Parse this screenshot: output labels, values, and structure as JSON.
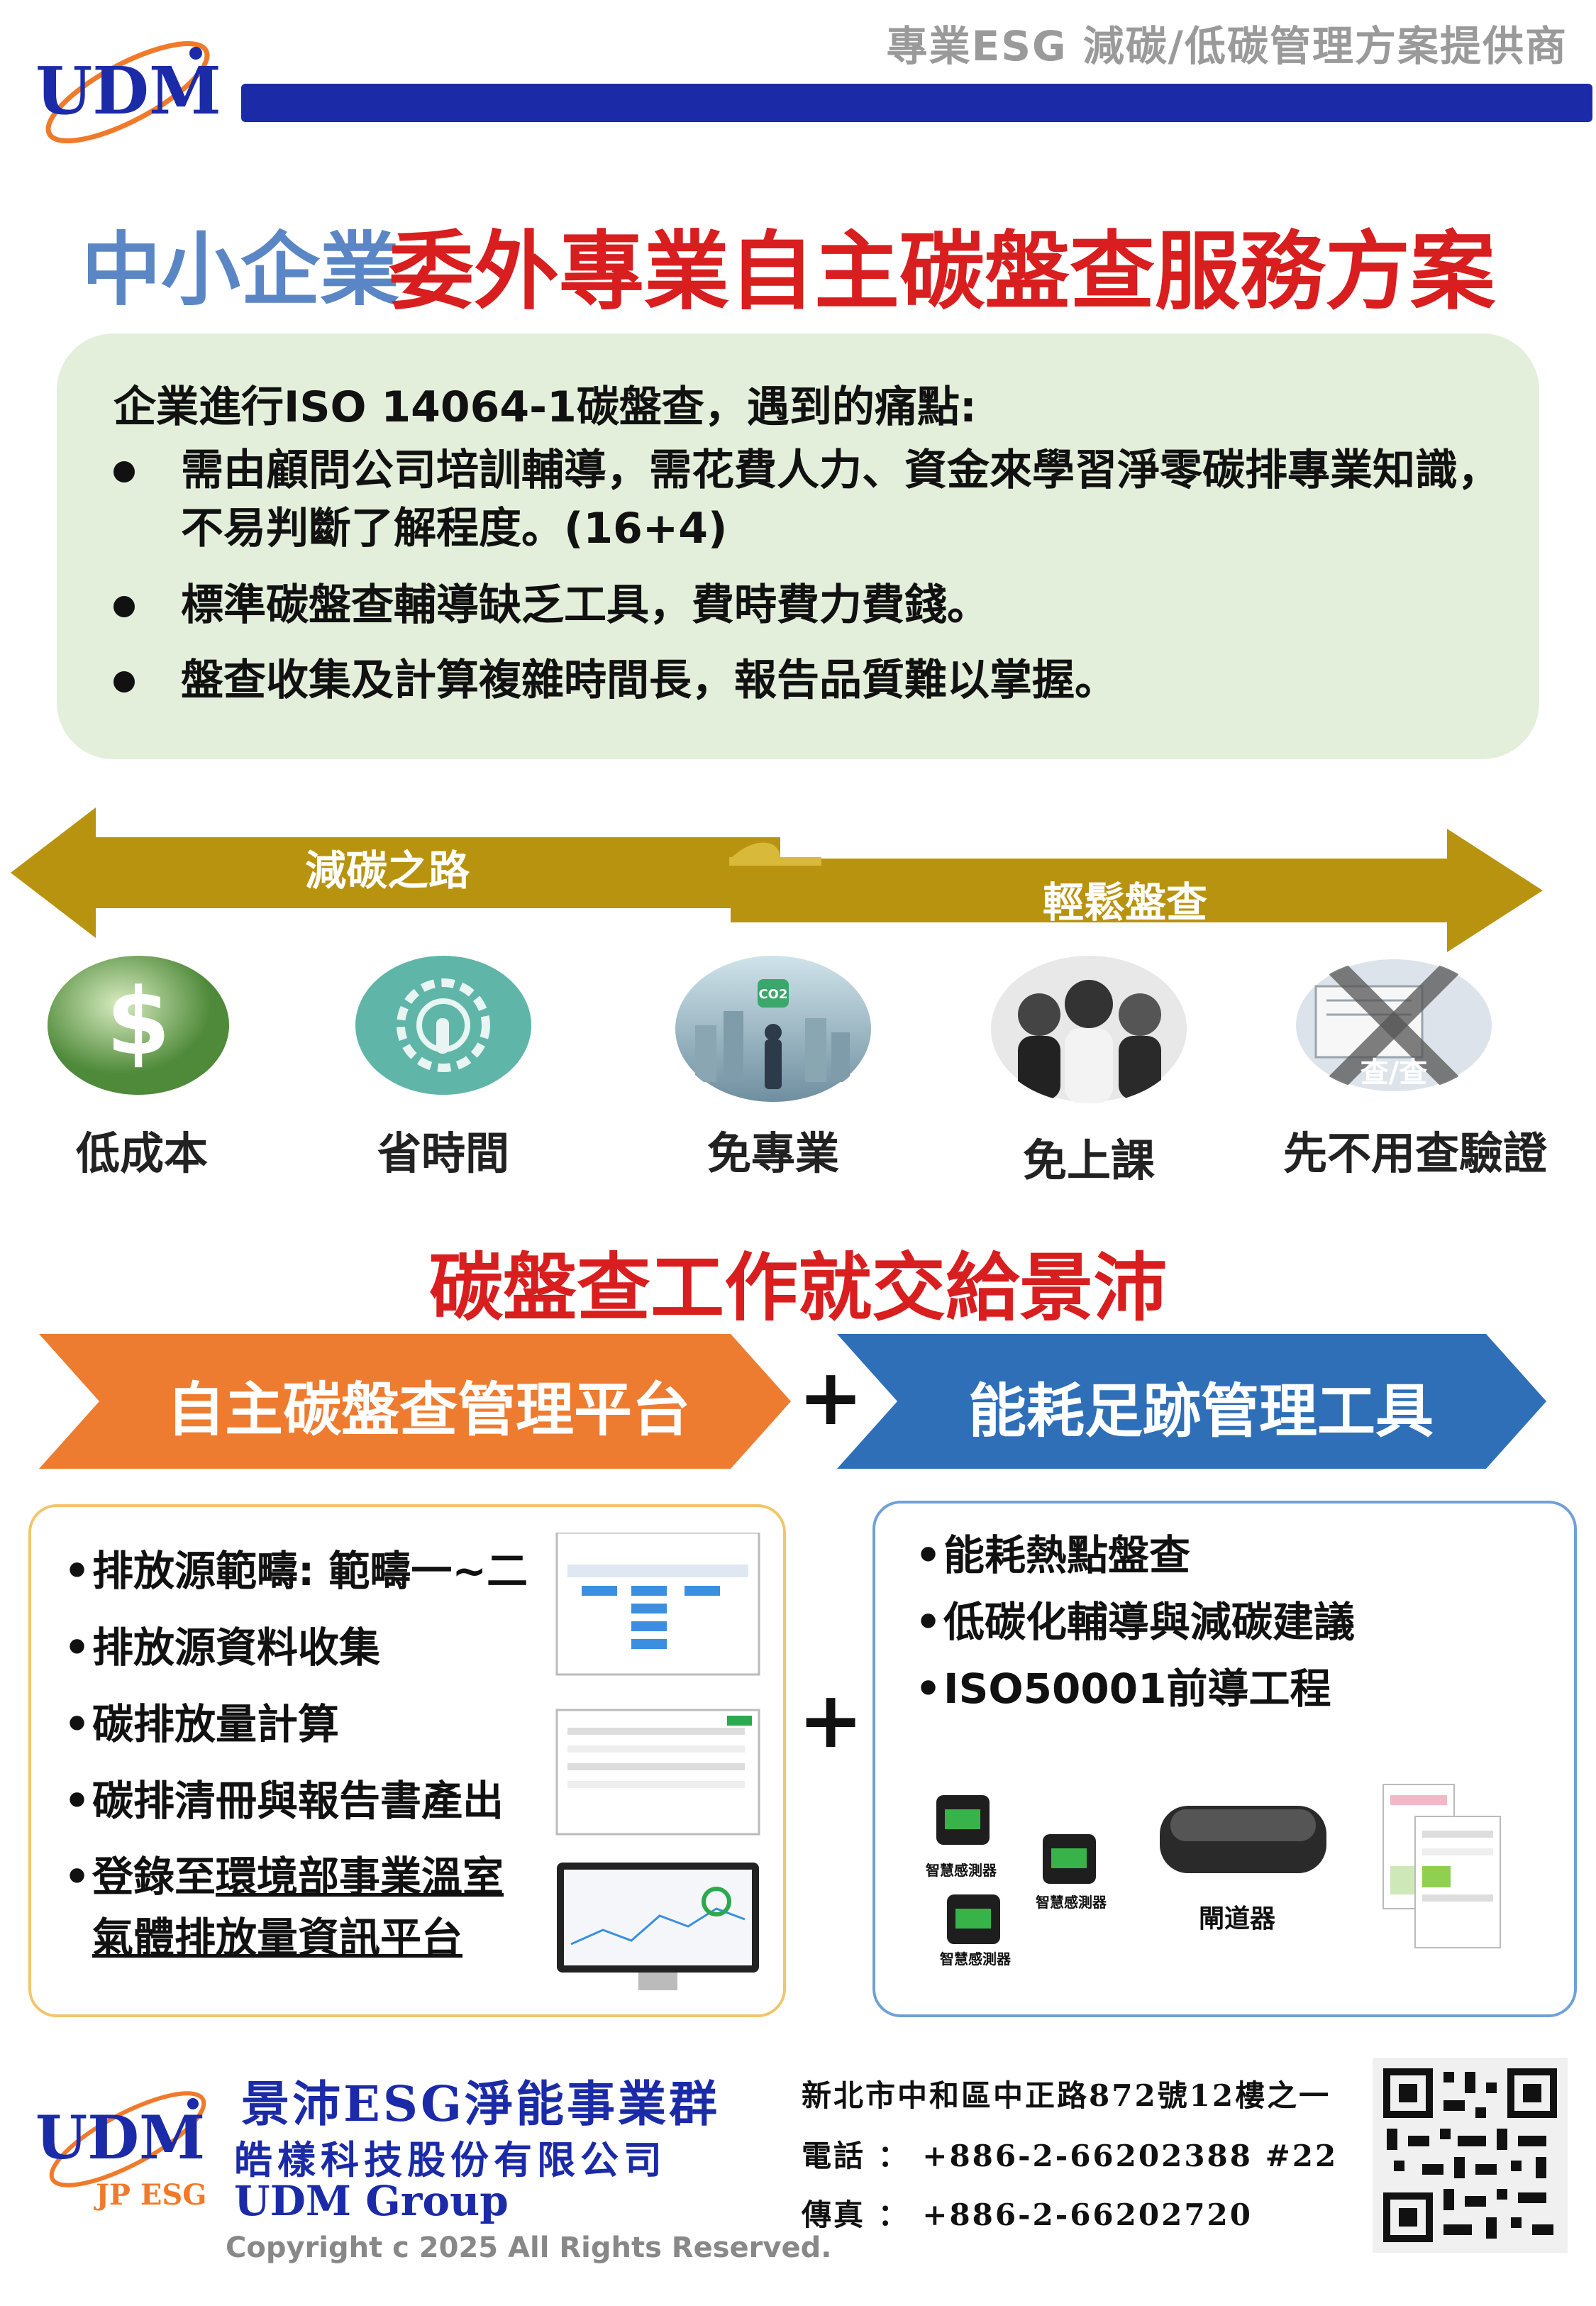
{
  "header": {
    "tagline": "專業ESG 減碳/低碳管理方案提供商",
    "logo_text": "UDM"
  },
  "title": {
    "prefix": "中小企業",
    "main": "委外專業自主碳盤查服務方案"
  },
  "pain_points": {
    "heading": "企業進行ISO 14064-1碳盤查，遇到的痛點:",
    "items": [
      "需由顧問公司培訓輔導，需花費人力、資金來學習淨零碳排專業知識， 不易判斷了解程度。(16+4)",
      "標準碳盤查輔導缺乏工具，費時費力費錢。",
      "盤查收集及計算複雜時間長，報告品質難以掌握。"
    ]
  },
  "arrows": {
    "left_label": "減碳之路",
    "right_label": "輕鬆盤查"
  },
  "benefits": [
    {
      "label": "低成本",
      "icon": "dollar-icon"
    },
    {
      "label": "省時間",
      "icon": "gear-hand-icon"
    },
    {
      "label": "免專業",
      "icon": "co2-city-icon"
    },
    {
      "label": "免上課",
      "icon": "people-icon"
    },
    {
      "label": "先不用查驗證",
      "icon": "no-verify-icon",
      "overlay_text": "查/查"
    }
  ],
  "section2": {
    "heading": "碳盤查工作就交給景沛",
    "left_chevron": "自主碳盤查管理平台",
    "plus": "+",
    "right_chevron": "能耗足跡管理工具"
  },
  "left_features": [
    "排放源範疇: 範疇一~二",
    "排放源資料收集",
    "碳排放量計算",
    "碳排清冊與報告書產出"
  ],
  "left_feature_last": {
    "prefix": "登錄至",
    "line1_underlined": "環境部事業溫室",
    "line2_underlined": "氣體排放量資訊平台"
  },
  "right_features": [
    "能耗熱點盤查",
    "低碳化輔導與減碳建議",
    "ISO50001前導工程"
  ],
  "devices": {
    "sensor_label": "智慧感測器",
    "gateway_label": "閘道器"
  },
  "footer": {
    "group_name": "景沛ESG淨能事業群",
    "company": "皓樣科技股份有限公司",
    "group_en": "UDM Group",
    "logo_sub": "JP ESG",
    "address": "新北市中和區中正路872號12樓之一",
    "phone_label": "電話 ：",
    "phone": "+886-2-66202388 #22",
    "fax_label": "傳真 ：",
    "fax": "+886-2-66202720",
    "copyright": "Copyright c 2025 All Rights Reserved."
  },
  "colors": {
    "brand_blue": "#1b2ba8",
    "title_red": "#d81e1e",
    "arrow_gold": "#b8930f",
    "chevron_orange": "#ee7c30",
    "chevron_blue": "#2f6fb8",
    "pain_bg": "#e3efda"
  }
}
